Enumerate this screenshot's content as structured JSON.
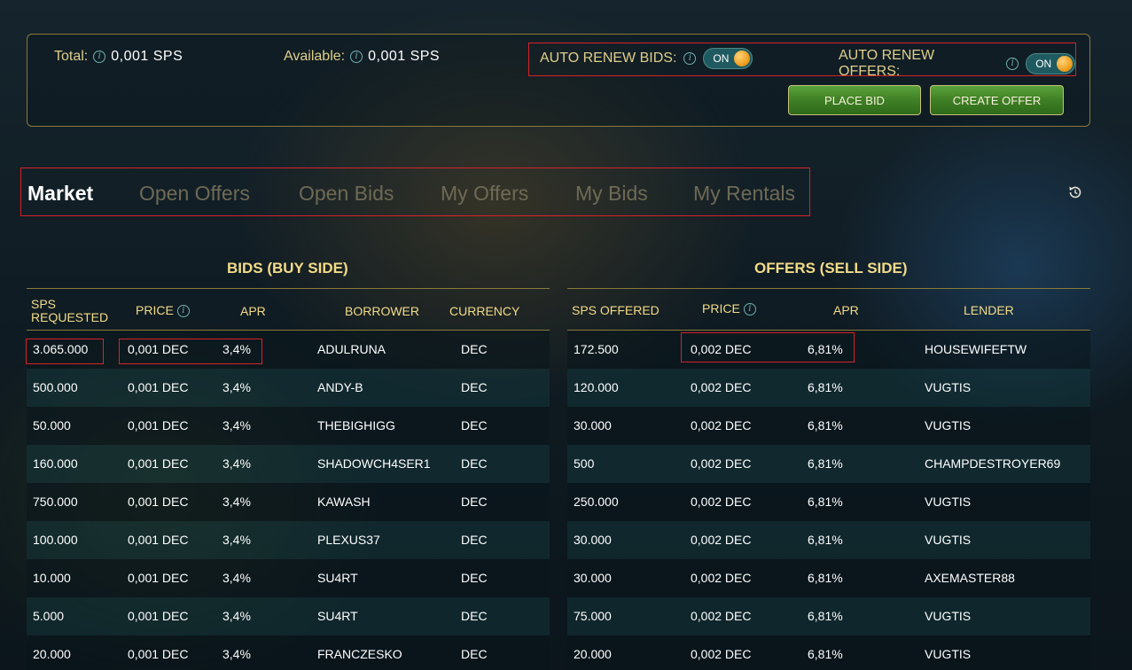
{
  "balances": {
    "total_label": "Total:",
    "total_value": "0,001 SPS",
    "available_label": "Available:",
    "available_value": "0,001 SPS"
  },
  "auto_renew": {
    "bids_label": "AUTO RENEW BIDS:",
    "bids_state": "ON",
    "offers_label": "AUTO RENEW OFFERS:",
    "offers_state": "ON"
  },
  "actions": {
    "place_bid": "PLACE BID",
    "create_offer": "CREATE OFFER"
  },
  "tabs": [
    {
      "label": "Market",
      "active": true
    },
    {
      "label": "Open Offers"
    },
    {
      "label": "Open Bids"
    },
    {
      "label": "My Offers"
    },
    {
      "label": "My Bids"
    },
    {
      "label": "My Rentals"
    }
  ],
  "bids": {
    "title": "BIDS (BUY SIDE)",
    "headers": {
      "sps_line1": "SPS",
      "sps_line2": "REQUESTED",
      "price": "PRICE",
      "apr": "APR",
      "borrower": "BORROWER",
      "currency": "CURRENCY"
    },
    "rows": [
      {
        "sps": "3.065.000",
        "price": "0,001 DEC",
        "apr": "3,4%",
        "borrower": "ADULRUNA",
        "currency": "DEC"
      },
      {
        "sps": "500.000",
        "price": "0,001 DEC",
        "apr": "3,4%",
        "borrower": "ANDY-B",
        "currency": "DEC"
      },
      {
        "sps": "50.000",
        "price": "0,001 DEC",
        "apr": "3,4%",
        "borrower": "THEBIGHIGG",
        "currency": "DEC"
      },
      {
        "sps": "160.000",
        "price": "0,001 DEC",
        "apr": "3,4%",
        "borrower": "SHADOWCH4SER1",
        "currency": "DEC"
      },
      {
        "sps": "750.000",
        "price": "0,001 DEC",
        "apr": "3,4%",
        "borrower": "KAWASH",
        "currency": "DEC"
      },
      {
        "sps": "100.000",
        "price": "0,001 DEC",
        "apr": "3,4%",
        "borrower": "PLEXUS37",
        "currency": "DEC"
      },
      {
        "sps": "10.000",
        "price": "0,001 DEC",
        "apr": "3,4%",
        "borrower": "SU4RT",
        "currency": "DEC"
      },
      {
        "sps": "5.000",
        "price": "0,001 DEC",
        "apr": "3,4%",
        "borrower": "SU4RT",
        "currency": "DEC"
      },
      {
        "sps": "20.000",
        "price": "0,001 DEC",
        "apr": "3,4%",
        "borrower": "FRANCZESKO",
        "currency": "DEC"
      }
    ]
  },
  "offers": {
    "title": "OFFERS (SELL SIDE)",
    "headers": {
      "sps": "SPS OFFERED",
      "price": "PRICE",
      "apr": "APR",
      "lender": "LENDER"
    },
    "rows": [
      {
        "sps": "172.500",
        "price": "0,002 DEC",
        "apr": "6,81%",
        "lender": "HOUSEWIFEFTW"
      },
      {
        "sps": "120.000",
        "price": "0,002 DEC",
        "apr": "6,81%",
        "lender": "VUGTIS"
      },
      {
        "sps": "30.000",
        "price": "0,002 DEC",
        "apr": "6,81%",
        "lender": "VUGTIS"
      },
      {
        "sps": "500",
        "price": "0,002 DEC",
        "apr": "6,81%",
        "lender": "CHAMPDESTROYER69"
      },
      {
        "sps": "250.000",
        "price": "0,002 DEC",
        "apr": "6,81%",
        "lender": "VUGTIS"
      },
      {
        "sps": "30.000",
        "price": "0,002 DEC",
        "apr": "6,81%",
        "lender": "VUGTIS"
      },
      {
        "sps": "30.000",
        "price": "0,002 DEC",
        "apr": "6,81%",
        "lender": "AXEMASTER88"
      },
      {
        "sps": "75.000",
        "price": "0,002 DEC",
        "apr": "6,81%",
        "lender": "VUGTIS"
      },
      {
        "sps": "20.000",
        "price": "0,002 DEC",
        "apr": "6,81%",
        "lender": "VUGTIS"
      }
    ]
  },
  "icons": {
    "info": "info-icon",
    "refresh": "refresh-icon"
  },
  "colors": {
    "accent_gold": "#f3dc88",
    "button_green": "#3f7f25",
    "highlight_red": "#d8222a",
    "toggle_teal": "#1f5a60"
  }
}
